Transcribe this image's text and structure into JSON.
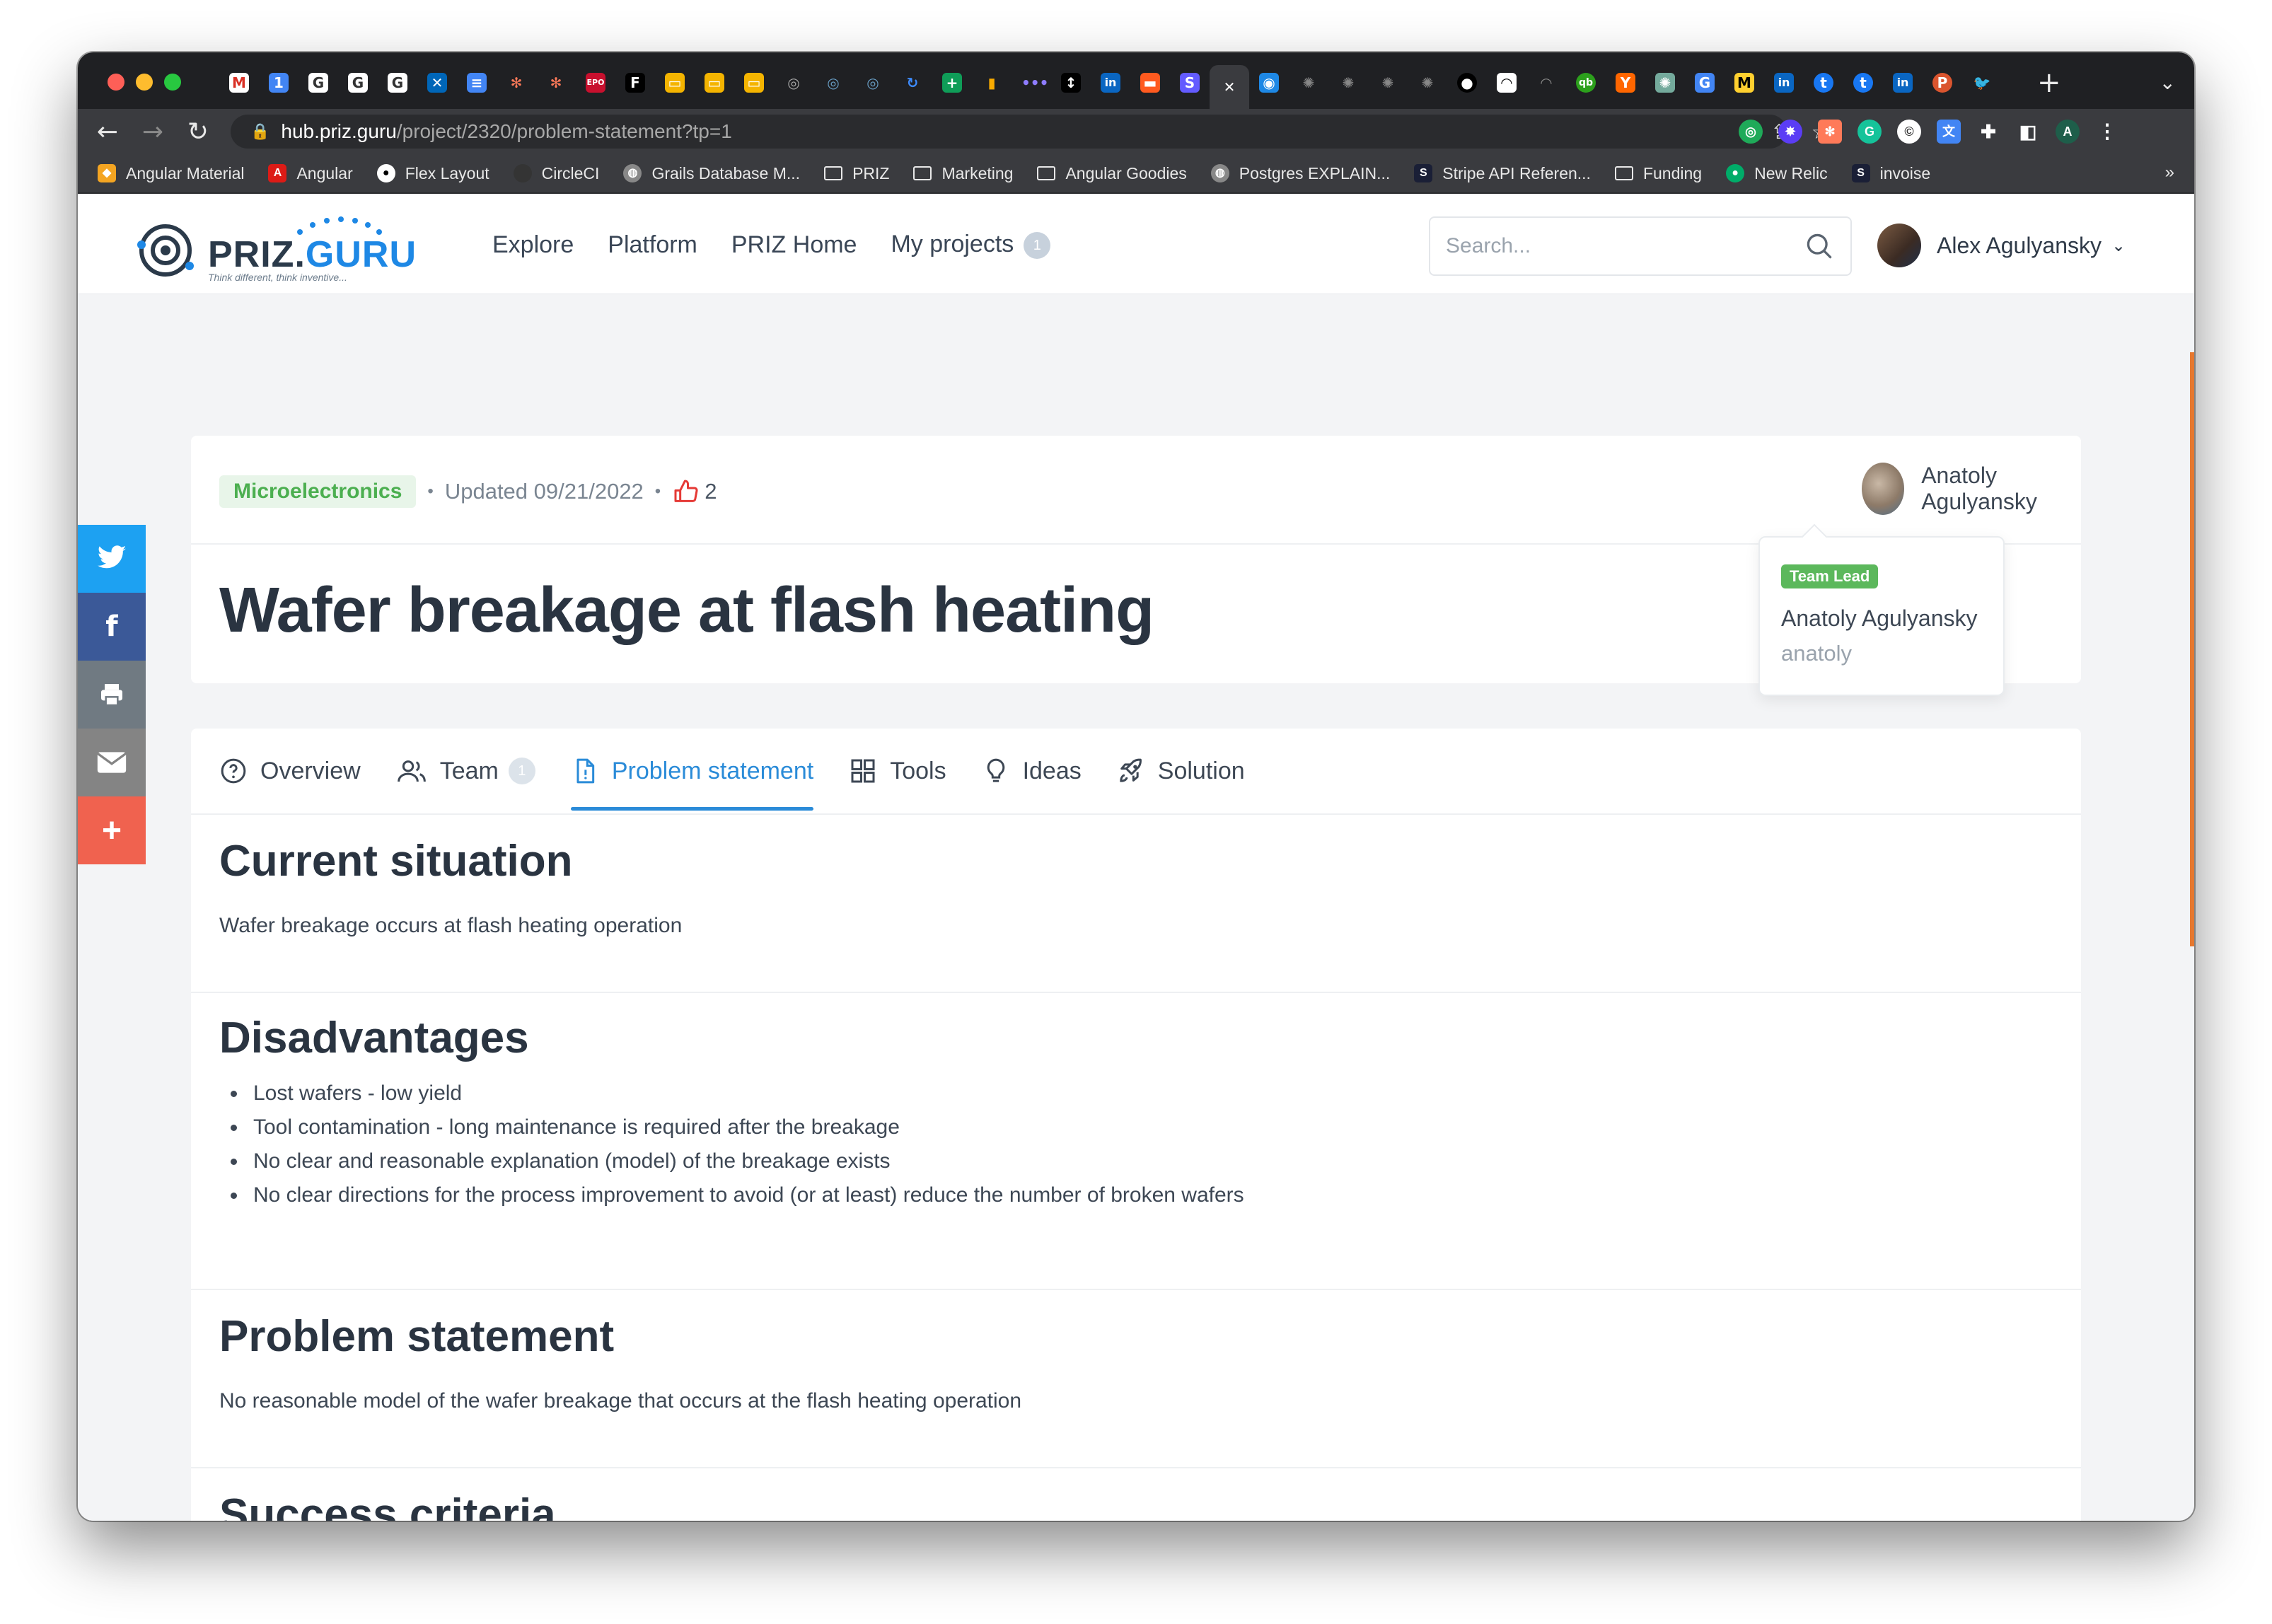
{
  "browser": {
    "tabs_overflow_label": "+",
    "address": {
      "host": "hub.priz.guru",
      "path": "/project/2320/problem-statement?tp=1"
    },
    "bookmarks": [
      {
        "label": "Angular Material",
        "color": "#f4a522"
      },
      {
        "label": "Angular",
        "color": "#dd1b16"
      },
      {
        "label": "Flex Layout",
        "color": "#444"
      },
      {
        "label": "CircleCI",
        "color": "#343434"
      },
      {
        "label": "Grails Database M...",
        "color": "#666"
      },
      {
        "label": "PRIZ",
        "color": "#3a3b3f"
      },
      {
        "label": "Marketing",
        "color": "#3a3b3f"
      },
      {
        "label": "Angular Goodies",
        "color": "#3a3b3f"
      },
      {
        "label": "Postgres EXPLAIN...",
        "color": "#666"
      },
      {
        "label": "Stripe API Referen...",
        "color": "#1a1f36"
      },
      {
        "label": "Funding",
        "color": "#3a3b3f"
      },
      {
        "label": "New Relic",
        "color": "#1ce783"
      },
      {
        "label": "invoise",
        "color": "#1a1f36"
      }
    ],
    "bookmarks_more": "»"
  },
  "header": {
    "logo_word_a": "PRIZ.",
    "logo_word_b": "GURU",
    "logo_tagline": "Think different, think inventive...",
    "nav": [
      {
        "label": "Explore"
      },
      {
        "label": "Platform"
      },
      {
        "label": "PRIZ Home"
      },
      {
        "label": "My projects",
        "badge": "1"
      }
    ],
    "search_placeholder": "Search...",
    "user_name": "Alex Agulyansky"
  },
  "project": {
    "category": "Microelectronics",
    "updated": "Updated 09/21/2022",
    "likes": "2",
    "title": "Wafer breakage at flash heating",
    "owner": "Anatoly Agulyansky",
    "popover": {
      "role": "Team Lead",
      "name": "Anatoly Agulyansky",
      "handle": "anatoly"
    }
  },
  "tabs": [
    {
      "label": "Overview",
      "icon": "question-circle-icon"
    },
    {
      "label": "Team",
      "icon": "users-icon",
      "badge": "1"
    },
    {
      "label": "Problem statement",
      "icon": "document-icon",
      "active": true
    },
    {
      "label": "Tools",
      "icon": "grid-icon"
    },
    {
      "label": "Ideas",
      "icon": "lightbulb-icon"
    },
    {
      "label": "Solution",
      "icon": "rocket-icon"
    }
  ],
  "sections": {
    "current": {
      "heading": "Current situation",
      "text": "Wafer breakage occurs at flash heating operation"
    },
    "disadvantages": {
      "heading": "Disadvantages",
      "items": [
        "Lost wafers - low yield",
        "Tool contamination - long maintenance is required after the breakage",
        "No clear and reasonable explanation (model) of the breakage exists",
        "No clear directions for the process improvement to avoid (or at least) reduce the number of broken wafers"
      ]
    },
    "problem": {
      "heading": "Problem statement",
      "text": "No reasonable model of the wafer breakage that occurs at the flash heating operation"
    },
    "success": {
      "heading": "Success criteria"
    }
  },
  "social": [
    "twitter-icon",
    "facebook-icon",
    "print-icon",
    "email-icon",
    "add-icon"
  ],
  "colors": {
    "accent": "#2a8bd8",
    "category_green": "#4caf50",
    "like_red": "#e53935"
  }
}
